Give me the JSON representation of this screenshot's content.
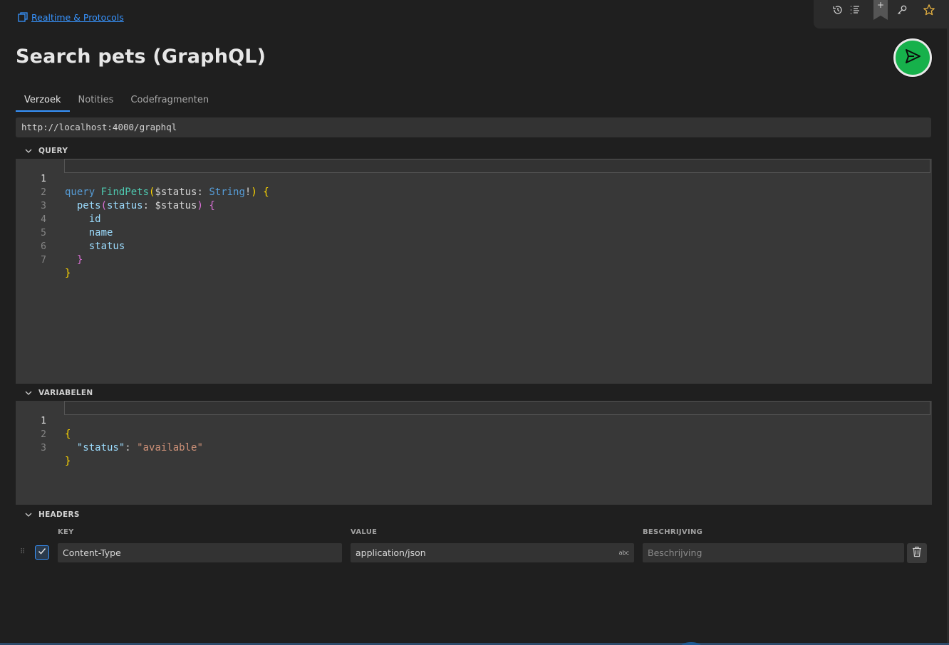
{
  "breadcrumb": {
    "label": "Realtime & Protocols"
  },
  "title": "Search pets (GraphQL)",
  "tabs": [
    {
      "label": "Verzoek",
      "active": true
    },
    {
      "label": "Notities",
      "active": false
    },
    {
      "label": "Codefragmenten",
      "active": false
    }
  ],
  "url": "http://localhost:4000/graphql",
  "sections": {
    "query": "QUERY",
    "variables": "VARIABELEN",
    "headers": "HEADERS"
  },
  "query_lines": [
    "1",
    "2",
    "3",
    "4",
    "5",
    "6",
    "7"
  ],
  "variables_lines": [
    "1",
    "2",
    "3"
  ],
  "query_code": {
    "l1_kw": "query",
    "l1_fn": "FindPets",
    "l1_p": "(",
    "l1_var": "$status",
    "l1_colon": ": ",
    "l1_ty": "String",
    "l1_bang": "!",
    "l1_close": ")",
    "l1_brace": " {",
    "l2_field": "pets",
    "l2_p": "(",
    "l2_arg": "status",
    "l2_colon": ": ",
    "l2_var": "$status",
    "l2_close": ")",
    "l2_brace": " {",
    "l3": "id",
    "l4": "name",
    "l5": "status",
    "l6": "}",
    "l7": "}"
  },
  "variables_code": {
    "l1": "{",
    "l2_key": "\"status\"",
    "l2_colon": ": ",
    "l2_val": "\"available\"",
    "l3": "}"
  },
  "headers": {
    "columns": {
      "key": "KEY",
      "value": "VALUE",
      "description": "BESCHRIJVING"
    },
    "rows": [
      {
        "enabled": true,
        "key": "Content-Type",
        "value": "application/json",
        "description_placeholder": "Beschrijving"
      }
    ],
    "value_badge": "abc"
  },
  "colors": {
    "accent": "#3794ff",
    "send": "#16b14b",
    "background": "#1f1f1f",
    "editor": "#383838"
  },
  "icons": [
    "history-icon",
    "list-icon",
    "bookmark-icon",
    "key-icon",
    "star-icon",
    "send-icon",
    "chevron-down-icon",
    "trash-icon",
    "check-icon",
    "drag-handle-icon"
  ]
}
